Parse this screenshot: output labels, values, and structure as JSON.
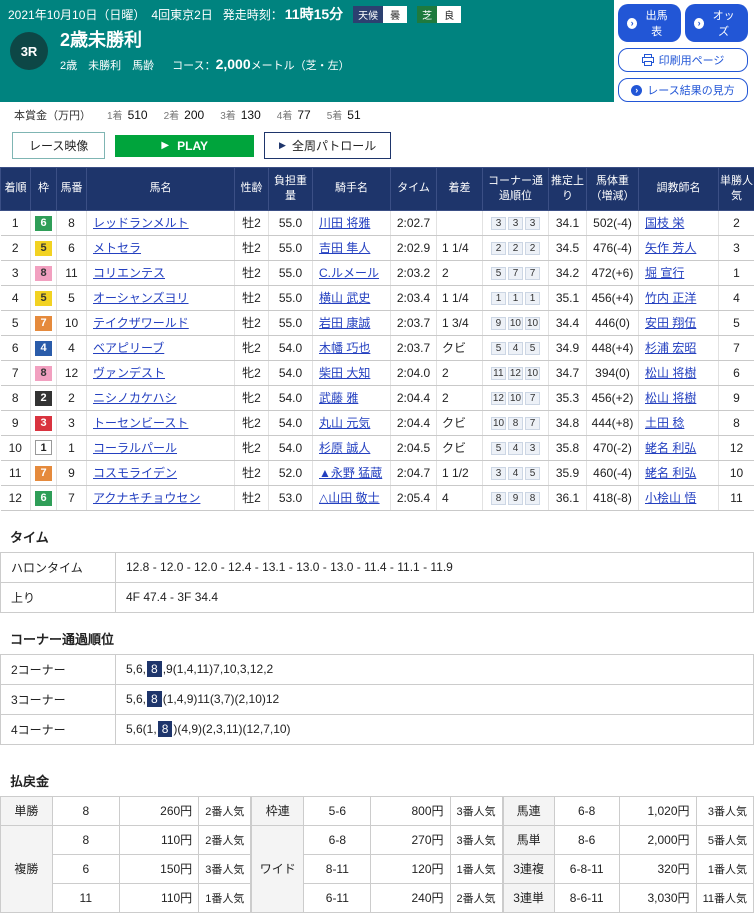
{
  "header": {
    "date_line": "2021年10月10日（日曜）　4回東京2日",
    "start_time_label": "発走時刻：",
    "start_time": "11時15分",
    "weather_label": "天候",
    "weather_value": "曇",
    "turf_label": "芝",
    "turf_value": "良",
    "btn_shutsuba": "出馬表",
    "btn_odds": "オッズ",
    "btn_print": "印刷用ページ",
    "btn_guide": "レース結果の見方"
  },
  "race": {
    "number": "3R",
    "title": "2歳未勝利",
    "conditions": "2歳　未勝利　馬齢",
    "course_label": "コース：",
    "course_value": "2,000",
    "course_unit": "メートル（芝・左）"
  },
  "prize": {
    "label": "本賞金（万円）",
    "items": [
      {
        "rank": "1着",
        "amount": "510"
      },
      {
        "rank": "2着",
        "amount": "200"
      },
      {
        "rank": "3着",
        "amount": "130"
      },
      {
        "rank": "4着",
        "amount": "77"
      },
      {
        "rank": "5着",
        "amount": "51"
      }
    ]
  },
  "video": {
    "race_video_label": "レース映像",
    "play_label": "PLAY",
    "patrol_label": "全周パトロール"
  },
  "results": {
    "headers": [
      "着順",
      "枠",
      "馬番",
      "馬名",
      "性齢",
      "負担重量",
      "騎手名",
      "タイム",
      "着差",
      "コーナー通過順位",
      "推定上り",
      "馬体重（増減）",
      "調教師名",
      "単勝人気"
    ],
    "rows": [
      {
        "pos": "1",
        "waku": "6",
        "num": "8",
        "horse": "レッドランメルト",
        "sex": "牡2",
        "weight": "55.0",
        "jockey": "川田 将雅",
        "time": "2:02.7",
        "margin": "",
        "corners": [
          "3",
          "3",
          "3"
        ],
        "last3f": "34.1",
        "body": "502(-4)",
        "trainer": "国枝 栄",
        "pop": "2"
      },
      {
        "pos": "2",
        "waku": "5",
        "num": "6",
        "horse": "メトセラ",
        "sex": "牡2",
        "weight": "55.0",
        "jockey": "吉田 隼人",
        "time": "2:02.9",
        "margin": "1 1/4",
        "corners": [
          "2",
          "2",
          "2"
        ],
        "last3f": "34.5",
        "body": "476(-4)",
        "trainer": "矢作 芳人",
        "pop": "3"
      },
      {
        "pos": "3",
        "waku": "8",
        "num": "11",
        "horse": "コリエンテス",
        "sex": "牡2",
        "weight": "55.0",
        "jockey": "C.ルメール",
        "time": "2:03.2",
        "margin": "2",
        "corners": [
          "5",
          "7",
          "7"
        ],
        "last3f": "34.2",
        "body": "472(+6)",
        "trainer": "堀 宣行",
        "pop": "1"
      },
      {
        "pos": "4",
        "waku": "5",
        "num": "5",
        "horse": "オーシャンズヨリ",
        "sex": "牡2",
        "weight": "55.0",
        "jockey": "横山 武史",
        "time": "2:03.4",
        "margin": "1 1/4",
        "corners": [
          "1",
          "1",
          "1"
        ],
        "last3f": "35.1",
        "body": "456(+4)",
        "trainer": "竹内 正洋",
        "pop": "4"
      },
      {
        "pos": "5",
        "waku": "7",
        "num": "10",
        "horse": "テイクザワールド",
        "sex": "牡2",
        "weight": "55.0",
        "jockey": "岩田 康誠",
        "time": "2:03.7",
        "margin": "1 3/4",
        "corners": [
          "9",
          "10",
          "10"
        ],
        "last3f": "34.4",
        "body": "446(0)",
        "trainer": "安田 翔伍",
        "pop": "5"
      },
      {
        "pos": "6",
        "waku": "4",
        "num": "4",
        "horse": "ベアピリーブ",
        "sex": "牝2",
        "weight": "54.0",
        "jockey": "木幡 巧也",
        "time": "2:03.7",
        "margin": "クビ",
        "corners": [
          "5",
          "4",
          "5"
        ],
        "last3f": "34.9",
        "body": "448(+4)",
        "trainer": "杉浦 宏昭",
        "pop": "7"
      },
      {
        "pos": "7",
        "waku": "8",
        "num": "12",
        "horse": "ヴァンデスト",
        "sex": "牝2",
        "weight": "54.0",
        "jockey": "柴田 大知",
        "time": "2:04.0",
        "margin": "2",
        "corners": [
          "11",
          "12",
          "10"
        ],
        "last3f": "34.7",
        "body": "394(0)",
        "trainer": "松山 将樹",
        "pop": "6"
      },
      {
        "pos": "8",
        "waku": "2",
        "num": "2",
        "horse": "ニシノカケハシ",
        "sex": "牝2",
        "weight": "54.0",
        "jockey": "武藤 雅",
        "time": "2:04.4",
        "margin": "2",
        "corners": [
          "12",
          "10",
          "7"
        ],
        "last3f": "35.3",
        "body": "456(+2)",
        "trainer": "松山 将樹",
        "pop": "9"
      },
      {
        "pos": "9",
        "waku": "3",
        "num": "3",
        "horse": "トーセンビースト",
        "sex": "牝2",
        "weight": "54.0",
        "jockey": "丸山 元気",
        "time": "2:04.4",
        "margin": "クビ",
        "corners": [
          "10",
          "8",
          "7"
        ],
        "last3f": "34.8",
        "body": "444(+8)",
        "trainer": "土田 稔",
        "pop": "8"
      },
      {
        "pos": "10",
        "waku": "1",
        "num": "1",
        "horse": "コーラルパール",
        "sex": "牝2",
        "weight": "54.0",
        "jockey": "杉原 誠人",
        "time": "2:04.5",
        "margin": "クビ",
        "corners": [
          "5",
          "4",
          "3"
        ],
        "last3f": "35.8",
        "body": "470(-2)",
        "trainer": "蛯名 利弘",
        "pop": "12"
      },
      {
        "pos": "11",
        "waku": "7",
        "num": "9",
        "horse": "コスモライデン",
        "sex": "牡2",
        "weight": "52.0",
        "jockey": "▲永野 猛蔵",
        "time": "2:04.7",
        "margin": "1 1/2",
        "corners": [
          "3",
          "4",
          "5"
        ],
        "last3f": "35.9",
        "body": "460(-4)",
        "trainer": "蛯名 利弘",
        "pop": "10"
      },
      {
        "pos": "12",
        "waku": "6",
        "num": "7",
        "horse": "アクナキチョウセン",
        "sex": "牡2",
        "weight": "53.0",
        "jockey": "△山田 敬士",
        "time": "2:05.4",
        "margin": "4",
        "corners": [
          "8",
          "9",
          "8"
        ],
        "last3f": "36.1",
        "body": "418(-8)",
        "trainer": "小桧山 悟",
        "pop": "11"
      }
    ]
  },
  "time_section": {
    "title": "タイム",
    "rows": [
      {
        "label": "ハロンタイム",
        "value": "12.8 - 12.0 - 12.0 - 12.4 - 13.1 - 13.0 - 13.0 - 11.4 - 11.1 - 11.9"
      },
      {
        "label": "上り",
        "value": "4F 47.4 - 3F 34.4"
      }
    ]
  },
  "corner_section": {
    "title": "コーナー通過順位",
    "rows": [
      {
        "label": "2コーナー",
        "pre": "5,6,",
        "win": "8",
        "post": ",9(1,4,11)7,10,3,12,2"
      },
      {
        "label": "3コーナー",
        "pre": "5,6,",
        "win": "8",
        "post": "(1,4,9)11(3,7)(2,10)12"
      },
      {
        "label": "4コーナー",
        "pre": "5,6(1,",
        "win": "8",
        "post": ")(4,9)(2,3,11)(12,7,10)"
      }
    ]
  },
  "payout": {
    "title": "払戻金",
    "groups": [
      {
        "blocks": [
          {
            "type": "単勝",
            "rows": [
              [
                "8",
                "260円",
                "2番人気"
              ]
            ]
          },
          {
            "type": "複勝",
            "rows": [
              [
                "8",
                "110円",
                "2番人気"
              ],
              [
                "6",
                "150円",
                "3番人気"
              ],
              [
                "11",
                "110円",
                "1番人気"
              ]
            ]
          }
        ]
      },
      {
        "blocks": [
          {
            "type": "枠連",
            "rows": [
              [
                "5-6",
                "800円",
                "3番人気"
              ]
            ]
          },
          {
            "type": "ワイド",
            "rows": [
              [
                "6-8",
                "270円",
                "3番人気"
              ],
              [
                "8-11",
                "120円",
                "1番人気"
              ],
              [
                "6-11",
                "240円",
                "2番人気"
              ]
            ]
          }
        ]
      },
      {
        "blocks": [
          {
            "type": "馬連",
            "rows": [
              [
                "6-8",
                "1,020円",
                "3番人気"
              ]
            ]
          },
          {
            "type": "馬単",
            "rows": [
              [
                "8-6",
                "2,000円",
                "5番人気"
              ]
            ]
          },
          {
            "type": "3連複",
            "rows": [
              [
                "6-8-11",
                "320円",
                "1番人気"
              ]
            ]
          },
          {
            "type": "3連単",
            "rows": [
              [
                "8-6-11",
                "3,030円",
                "11番人気"
              ]
            ]
          }
        ]
      }
    ]
  },
  "colors": {
    "teal": "#00837f",
    "navy": "#1e356b",
    "link": "#2440c0",
    "green_button": "#00a43c",
    "blue_button": "#2256d6",
    "waku": {
      "1": {
        "bg": "#ffffff",
        "fg": "#222222",
        "border": "#999999"
      },
      "2": {
        "bg": "#333333",
        "fg": "#ffffff"
      },
      "3": {
        "bg": "#d9333f",
        "fg": "#ffffff"
      },
      "4": {
        "bg": "#2a5caa",
        "fg": "#ffffff"
      },
      "5": {
        "bg": "#f2d222",
        "fg": "#333333"
      },
      "6": {
        "bg": "#2f9e58",
        "fg": "#ffffff"
      },
      "7": {
        "bg": "#e58a3c",
        "fg": "#ffffff"
      },
      "8": {
        "bg": "#f2a0c0",
        "fg": "#333333"
      }
    }
  }
}
